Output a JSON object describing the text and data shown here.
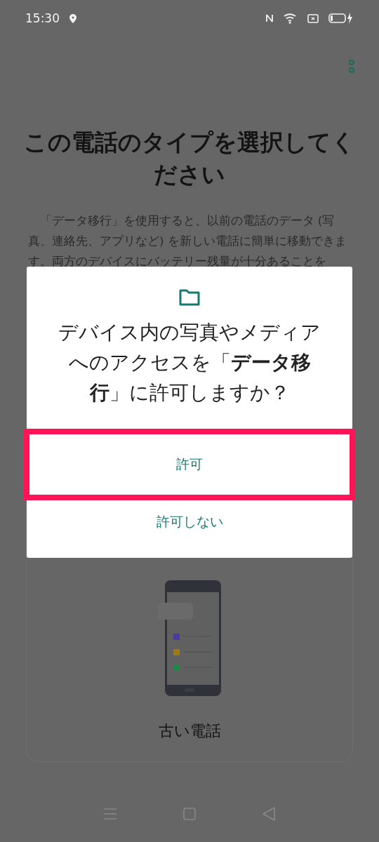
{
  "status_bar": {
    "time": "15:30"
  },
  "page": {
    "title": "この電話のタイプを選択してください",
    "description": "「データ移行」を使用すると、以前の電話のデータ (写真、連絡先、アプリなど) を新しい電話に簡単に移動できます。両方のデバイスにバッテリー残量が十分あることを",
    "card": {
      "label": "古い電話"
    }
  },
  "dialog": {
    "message": "デバイス内の写真やメディアへのアクセスを「**データ移行**」に許可しますか？",
    "buttons": [
      {
        "label": "許可",
        "highlighted": true
      },
      {
        "label": "許可しない",
        "highlighted": false
      }
    ]
  }
}
